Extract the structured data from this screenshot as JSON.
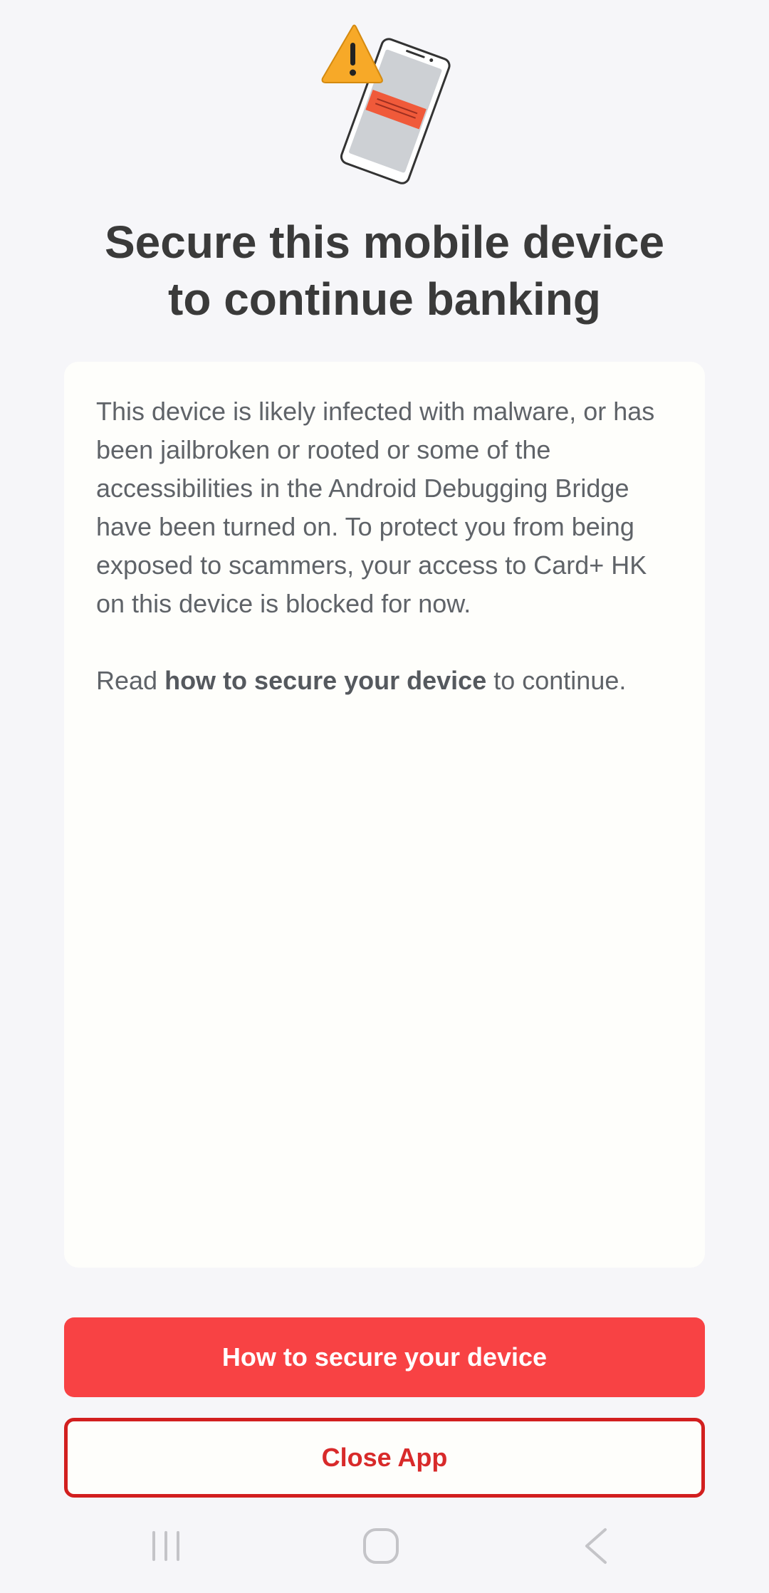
{
  "header": {
    "title_line1": "Secure this mobile device",
    "title_line2": "to continue banking",
    "illustration_icon": "phone-warning-icon"
  },
  "card": {
    "paragraph1": "This device is likely infected with malware, or has been jailbroken or rooted or some of the accessibilities in the Android Debugging Bridge have been turned on. To protect you from being exposed to scammers, your access to Card+ HK on this device is blocked for now.",
    "read_prefix": "Read ",
    "read_link": "how to secure your device",
    "read_suffix": " to continue."
  },
  "buttons": {
    "primary_label": "How to secure your device",
    "secondary_label": "Close App"
  },
  "navbar": {
    "recents_icon": "recents-icon",
    "home_icon": "home-icon",
    "back_icon": "back-icon"
  },
  "colors": {
    "background": "#f6f6f9",
    "card_background": "#fefefb",
    "primary_button": "#f84244",
    "secondary_border": "#d21f1f",
    "warning": "#f7a928",
    "title_text": "#3a3a3a",
    "body_text": "#5f6368"
  }
}
